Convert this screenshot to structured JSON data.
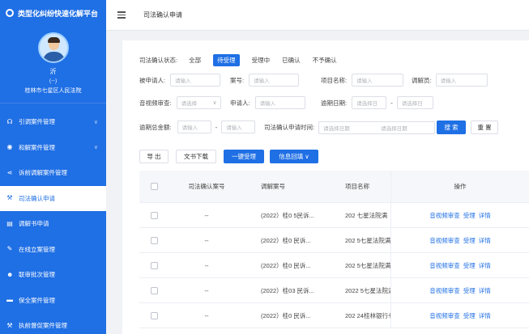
{
  "app": {
    "title": "类型化纠纷快速化解平台"
  },
  "profile": {
    "name": "沂",
    "role": "(--)",
    "org": "桂林市七星区人民法院"
  },
  "menu": [
    {
      "label": "引调案件管理",
      "icon": "bolt-icon",
      "glyph": "☊",
      "has_children": true
    },
    {
      "label": "和解案件管理",
      "icon": "eye-icon",
      "glyph": "◉",
      "has_children": true
    },
    {
      "label": "诉前调解案件管理",
      "icon": "share-icon",
      "glyph": "⋖",
      "has_children": false
    },
    {
      "label": "司法确认申请",
      "icon": "gavel-icon",
      "glyph": "⚒",
      "has_children": false,
      "active": true
    },
    {
      "label": "调解书申请",
      "icon": "document-icon",
      "glyph": "▤",
      "has_children": false
    },
    {
      "label": "在线立案管理",
      "icon": "edit-icon",
      "glyph": "✎",
      "has_children": false
    },
    {
      "label": "联审批次管理",
      "icon": "group-icon",
      "glyph": "☻",
      "has_children": false
    },
    {
      "label": "保全案件管理",
      "icon": "briefcase-icon",
      "glyph": "▬",
      "has_children": false
    },
    {
      "label": "执前督促案件管理",
      "icon": "gavel-icon",
      "glyph": "⚒",
      "has_children": false
    }
  ],
  "topbar": {
    "breadcrumb": "司法确认申请"
  },
  "filters": {
    "status_label": "司法确认状态:",
    "status_options": [
      "全部",
      "待受理",
      "受理中",
      "已确认",
      "不予确认"
    ],
    "status_active": 1,
    "applicant_label": "被申请人:",
    "applicant_placeholder": "请输入",
    "case_no_label": "案号:",
    "case_no_placeholder": "请输入",
    "project_label": "项目名称:",
    "project_placeholder": "请输入",
    "mediator_label": "调解员:",
    "mediator_placeholder": "请输入",
    "video_label": "音视频审查:",
    "video_placeholder": "请选择",
    "requester_label": "申请人:",
    "requester_placeholder": "请输入",
    "deadline_label": "逾期日期:",
    "deadline_start": "请选择日",
    "deadline_end": "请选择日",
    "amount_label": "逾期总金额:",
    "amount_min": "请输入",
    "amount_max": "请输入",
    "apply_time_label": "司法确认申请时间:",
    "apply_start": "请选择日期",
    "apply_end": "请选择日期",
    "search_button": "搜 索",
    "reset_button": "重 置",
    "dash": "-"
  },
  "toolbar": {
    "export": "导 出",
    "download": "文书下载",
    "batch_accept": "一键受理",
    "info_return": "信息回填",
    "info_return_arrow": "∨"
  },
  "table": {
    "headers": [
      "司法确认案号",
      "调解案号",
      "项目名称",
      "操作"
    ],
    "rows": [
      {
        "confirm_no": "--",
        "mediation_no": "(2022）桂0   5民诉...",
        "project": "202     七星法院满",
        "ops": [
          "音视频审查",
          "受理",
          "详情"
        ]
      },
      {
        "confirm_no": "--",
        "mediation_no": "(2022）桂0   民诉...",
        "project": "202     5七星法院满",
        "ops": [
          "音视频审查",
          "受理",
          "详情"
        ]
      },
      {
        "confirm_no": "--",
        "mediation_no": "(2022）桂0   民诉...",
        "project": "202     5七星法院满",
        "ops": [
          "音视频审查",
          "受理",
          "详情"
        ]
      },
      {
        "confirm_no": "--",
        "mediation_no": "(2022）桂03   民诉...",
        "project": "2022    5七星法院满",
        "ops": [
          "音视频审查",
          "受理",
          "详情"
        ]
      },
      {
        "confirm_no": "--",
        "mediation_no": "(2022）桂0   民诉...",
        "project": "202   24桂林银行七",
        "ops": [
          "音视频审查",
          "受理",
          "详情"
        ]
      }
    ]
  },
  "colors": {
    "brand": "#1f6fe5",
    "link": "#1f6fe5"
  }
}
